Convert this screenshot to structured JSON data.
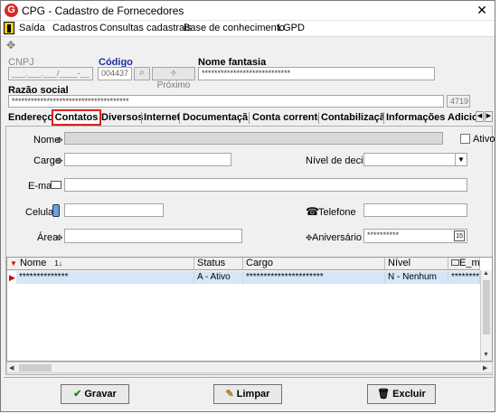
{
  "window": {
    "title": "CPG - Cadastro de Fornecedores",
    "app_icon": "G",
    "close": "✕"
  },
  "menu": [
    "Saída",
    "Cadastros",
    "Consultas cadastrais",
    "Base de conhecimento",
    "LGPD"
  ],
  "header": {
    "cnpj_label": "CNPJ",
    "cnpj_value": "___.___.___/____-__",
    "codigo_label": "Código",
    "codigo_value": "004437",
    "proximo_label": "Próximo",
    "fantasia_label": "Nome fantasia",
    "fantasia_value": "****************************",
    "razao_label": "Razão social",
    "razao_value": "*************************************",
    "razao_code": "4719"
  },
  "tabs": [
    "Endereço",
    "Contatos",
    "Diversos",
    "Internet",
    "Documentação",
    "Conta corrente",
    "Contabilização",
    "Informações Adiciona"
  ],
  "active_tab": "Contatos",
  "form": {
    "nome_label": "Nome",
    "ativo_label": "Ativo",
    "cargo_label": "Cargo",
    "nivel_label": "Nível de decisão",
    "email_label": "E-mail",
    "celular_label": "Celular",
    "telefone_label": "Telefone",
    "area_label": "Área",
    "aniversario_label": "Aniversário",
    "aniversario_value": "**********"
  },
  "grid": {
    "columns": [
      "Nome",
      "Status",
      "Cargo",
      "Nível",
      "E_ma"
    ],
    "rows": [
      {
        "nome": "**************",
        "status": "A - Ativo",
        "cargo": "**********************",
        "nivel": "N - Nenhum",
        "email": "**********"
      }
    ]
  },
  "buttons": {
    "gravar": "Gravar",
    "limpar": "Limpar",
    "excluir": "Excluir"
  },
  "colors": {
    "active_tab_border": "#e02020",
    "selected_row": "#d5e7f7",
    "exit_icon": "#ffd200"
  }
}
